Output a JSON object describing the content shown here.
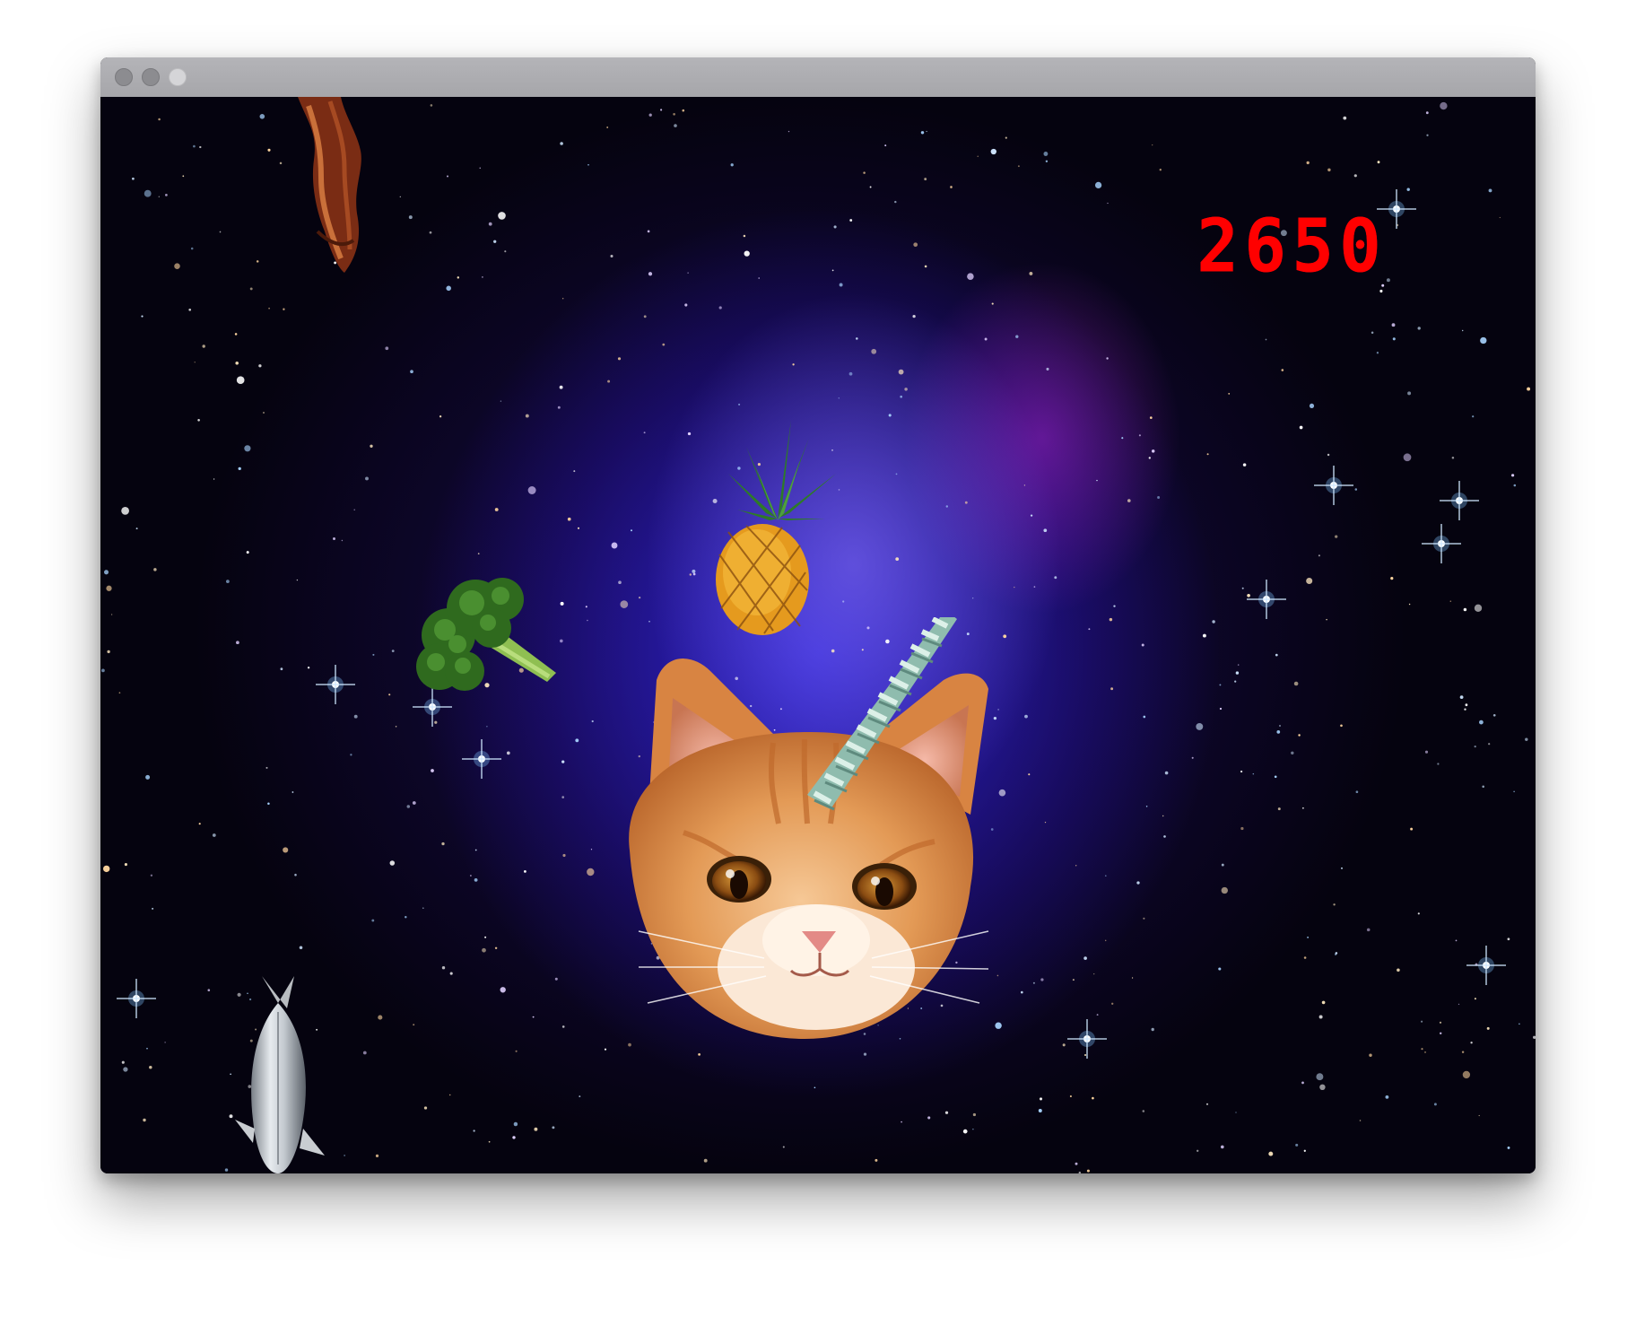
{
  "hud": {
    "score": "2650"
  },
  "window": {
    "buttons": [
      "close",
      "minimize",
      "maximize"
    ]
  },
  "sprites": [
    "bacon",
    "pineapple",
    "broccoli",
    "cat-head-with-unicorn-horn",
    "sardine-fish"
  ],
  "colors": {
    "score": "#ff0000",
    "nebula_blue": "#3a2cf0",
    "nebula_purple": "#a020d0",
    "space": "#020208"
  }
}
